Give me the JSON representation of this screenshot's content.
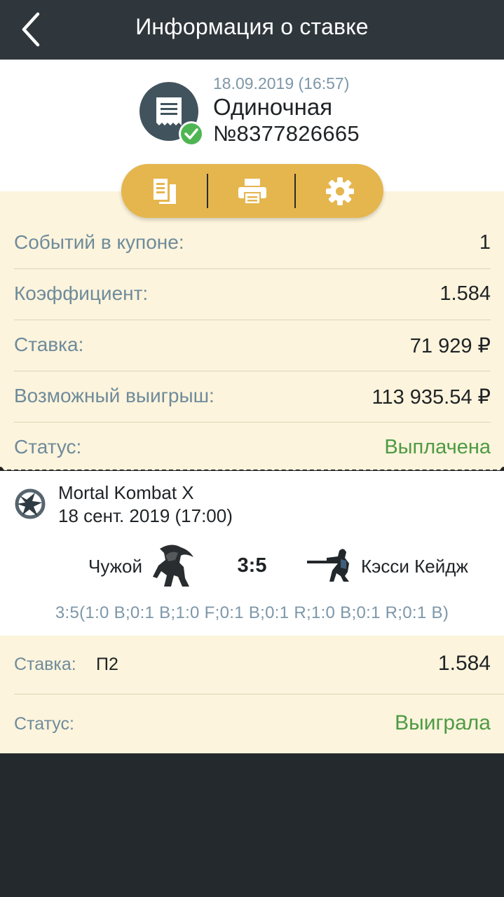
{
  "header": {
    "title": "Информация о ставке",
    "back_icon": "chevron-left-icon"
  },
  "bet": {
    "date": "18.09.2019 (16:57)",
    "type": "Одиночная",
    "number": "№8377826665",
    "icon": "receipt-icon",
    "status_icon": "check-circle-icon"
  },
  "actions": [
    {
      "icon": "copy-icon"
    },
    {
      "icon": "print-icon"
    },
    {
      "icon": "gear-icon"
    }
  ],
  "summary": [
    {
      "label": "Событий в купоне:",
      "value": "1"
    },
    {
      "label": "Коэффициент:",
      "value": "1.584"
    },
    {
      "label": "Ставка:",
      "value": "71 929 ₽"
    },
    {
      "label": "Возможный выигрыш:",
      "value": "113 935.54 ₽"
    },
    {
      "label": "Статус:",
      "value": "Выплачена"
    }
  ],
  "event": {
    "name": "Mortal Kombat X",
    "datetime": "18 сент. 2019 (17:00)",
    "team1": "Чужой",
    "team2": "Кэсси Кейдж",
    "score": "3:5",
    "score_details": "3:5(1:0 B;0:1 B;1:0 F;0:1 B;0:1 R;1:0 B;0:1 R;0:1 B)"
  },
  "selection": {
    "stake_label": "Ставка:",
    "pick": "П2",
    "odds": "1.584",
    "status_label": "Статус:",
    "status_value": "Выиграла"
  },
  "colors": {
    "header_bg": "#2f373c",
    "panel_bg": "#fcf4dc",
    "accent": "#e5b64e",
    "status_green": "#4e9a44",
    "label_blue": "#6f8b9c"
  }
}
